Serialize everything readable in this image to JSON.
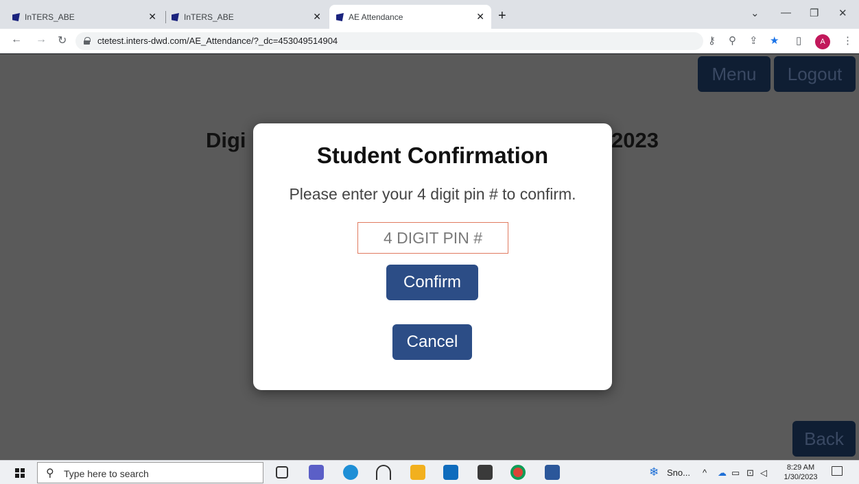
{
  "browser": {
    "tabs": [
      {
        "title": "InTERS_ABE",
        "active": false
      },
      {
        "title": "InTERS_ABE",
        "active": false
      },
      {
        "title": "AE Attendance",
        "active": true
      }
    ],
    "url": "ctetest.inters-dwd.com/AE_Attendance/?_dc=453049514904",
    "profile_initial": "A"
  },
  "page": {
    "menu_label": "Menu",
    "logout_label": "Logout",
    "back_label": "Back",
    "bg_title_left": "Digi",
    "bg_title_right": "2023"
  },
  "modal": {
    "title": "Student Confirmation",
    "message": "Please enter your 4 digit pin # to confirm.",
    "pin_placeholder": "4 DIGIT PIN #",
    "confirm_label": "Confirm",
    "cancel_label": "Cancel"
  },
  "taskbar": {
    "search_placeholder": "Type here to search",
    "weather_label": "Sno...",
    "time": "8:29 AM",
    "date": "1/30/2023"
  },
  "colors": {
    "accent": "#2c4d86",
    "overlay": "#5a5a5a",
    "input_border": "#e07a5f"
  }
}
